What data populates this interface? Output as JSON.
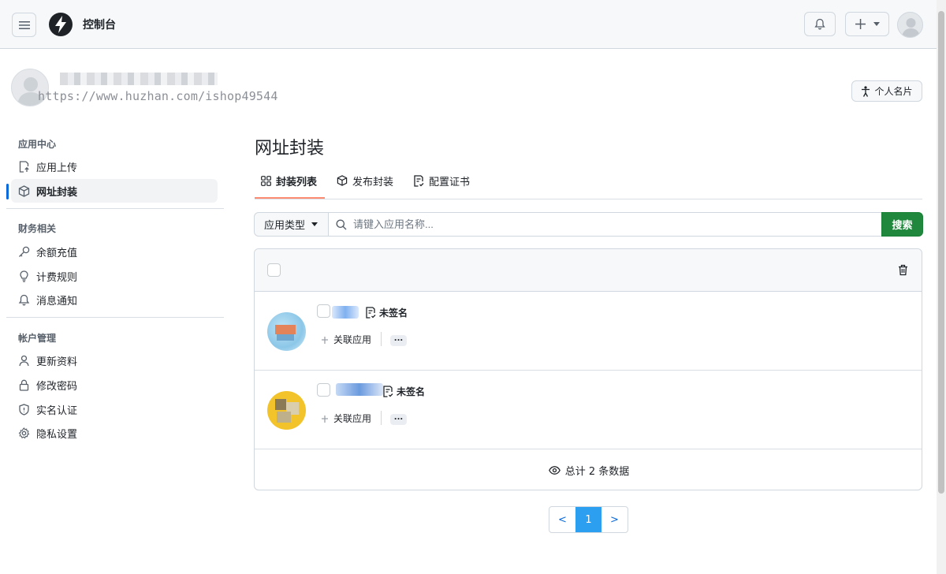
{
  "header": {
    "title": "控制台"
  },
  "profile": {
    "watermark": "https://www.huzhan.com/ishop49544",
    "card_button": "个人名片"
  },
  "sidebar": {
    "sections": [
      {
        "title": "应用中心",
        "items": [
          {
            "label": "应用上传",
            "icon": "upload-file-icon"
          },
          {
            "label": "网址封装",
            "icon": "package-icon",
            "active": true
          }
        ]
      },
      {
        "title": "财务相关",
        "items": [
          {
            "label": "余额充值",
            "icon": "key-icon"
          },
          {
            "label": "计费规则",
            "icon": "lightbulb-icon"
          },
          {
            "label": "消息通知",
            "icon": "bell-icon"
          }
        ]
      },
      {
        "title": "帐户管理",
        "items": [
          {
            "label": "更新资料",
            "icon": "person-icon"
          },
          {
            "label": "修改密码",
            "icon": "lock-icon"
          },
          {
            "label": "实名认证",
            "icon": "shield-icon"
          },
          {
            "label": "隐私设置",
            "icon": "gear-icon"
          }
        ]
      }
    ]
  },
  "main": {
    "title": "网址封装",
    "tabs": [
      {
        "label": "封装列表",
        "icon": "grid-icon",
        "active": true
      },
      {
        "label": "发布封装",
        "icon": "package-icon"
      },
      {
        "label": "配置证书",
        "icon": "file-cert-icon"
      }
    ],
    "search": {
      "type_label": "应用类型",
      "placeholder": "请键入应用名称...",
      "button": "搜索"
    },
    "rows": [
      {
        "status": "未签名",
        "link_label": "关联应用",
        "more": "..."
      },
      {
        "status": "未签名",
        "link_label": "关联应用",
        "more": "..."
      }
    ],
    "total": "总计 2 条数据"
  },
  "pagination": {
    "prev": "<",
    "current": "1",
    "next": ">"
  },
  "colors": {
    "accent": "#0969da",
    "primary_button": "#1f883d",
    "tab_underline": "#fd8c73",
    "pager_active": "#2d9ff0"
  }
}
